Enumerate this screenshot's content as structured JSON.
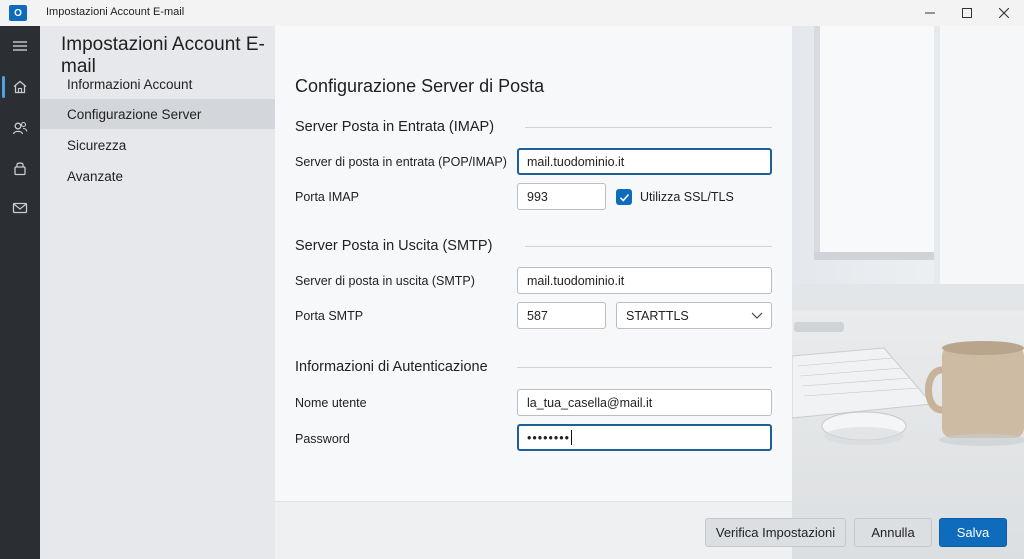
{
  "window": {
    "title": "Impostazioni Account E-mail",
    "app_icon_letter": "O"
  },
  "rail": {
    "items": [
      "menu-icon",
      "home-icon",
      "contacts-icon",
      "lock-icon",
      "mail-icon"
    ],
    "active": "home-icon"
  },
  "sidebar": {
    "title": "Impostazioni Account E-mail",
    "items": [
      {
        "label": "Informazioni Account",
        "active": false
      },
      {
        "label": "Configurazione Server",
        "active": true
      },
      {
        "label": "Sicurezza",
        "active": false
      },
      {
        "label": "Avanzate",
        "active": false
      }
    ]
  },
  "main": {
    "title": "Configurazione Server di Posta",
    "incoming": {
      "title": "Server Posta in Entrata (IMAP)",
      "server_label": "Server di posta in entrata (POP/IMAP)",
      "server_value": "mail.tuodominio.it",
      "port_label": "Porta IMAP",
      "port_value": "993",
      "ssl_label": "Utilizza SSL/TLS",
      "ssl_checked": true
    },
    "outgoing": {
      "title": "Server Posta in Uscita (SMTP)",
      "server_label": "Server di posta in uscita (SMTP)",
      "server_value": "mail.tuodominio.it",
      "port_label": "Porta SMTP",
      "port_value": "587",
      "security_value": "STARTTLS"
    },
    "auth": {
      "title": "Informazioni di Autenticazione",
      "username_label": "Nome utente",
      "username_value": "la_tua_casella@mail.it",
      "password_label": "Password",
      "password_value": "••••••••"
    }
  },
  "footer": {
    "verify_label": "Verifica Impostazioni",
    "cancel_label": "Annulla",
    "save_label": "Salva"
  },
  "colors": {
    "accent": "#0f6cbd",
    "rail": "#2b2f33",
    "sidebar": "#e6e8eb"
  }
}
